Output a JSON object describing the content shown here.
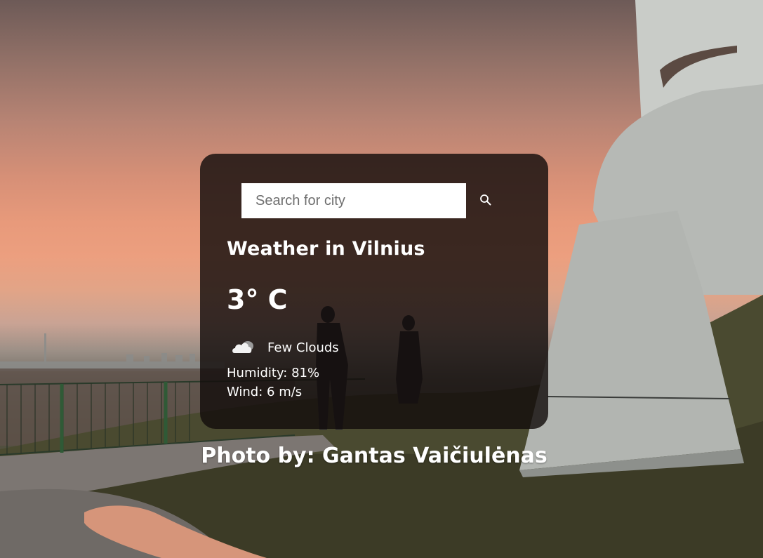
{
  "search": {
    "placeholder": "Search for city",
    "value": "",
    "button_icon": "search-icon"
  },
  "weather": {
    "title": "Weather in Vilnius",
    "temperature": "3° C",
    "condition_icon": "cloud-icon",
    "description": "Few Clouds",
    "humidity": "Humidity: 81%",
    "wind": "Wind: 6 m/s"
  },
  "credit": {
    "text": "Photo by: Gantas Vaičiulėnas"
  },
  "colors": {
    "card_background": "#140e0c",
    "text": "#ffffff",
    "input_background": "#ffffff"
  }
}
